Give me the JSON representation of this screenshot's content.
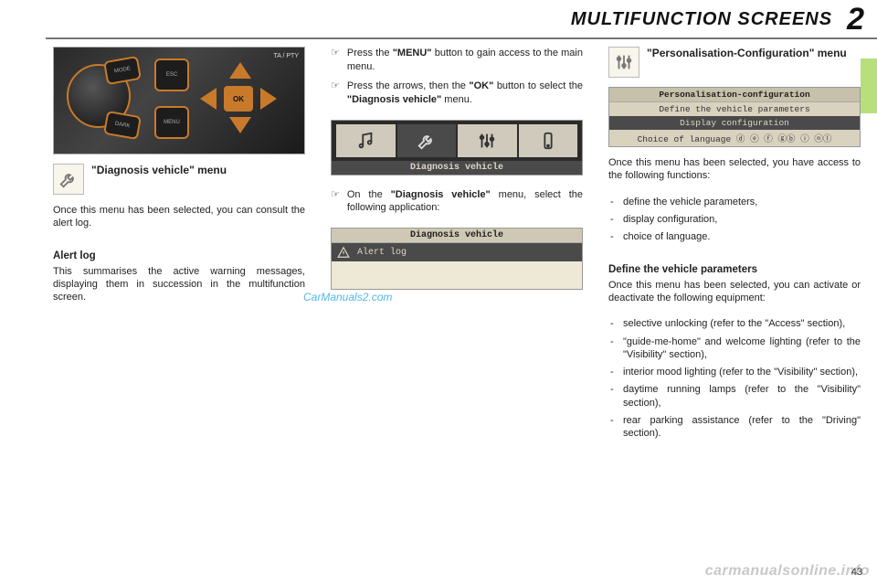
{
  "header": {
    "title": "MULTIFUNCTION SCREENS",
    "chapter": "2"
  },
  "col1": {
    "panel_labels": {
      "mode": "MODE",
      "dark": "DARK",
      "esc": "ESC",
      "menu": "MENU",
      "ok": "OK",
      "tapty": "TA / PTY"
    },
    "callout_title": "\"Diagnosis vehicle\" menu",
    "intro": "Once this menu has been selected, you can consult the alert log.",
    "alert_head": "Alert log",
    "alert_body": "This summarises the active warning messages, displaying them in succession in the multifunction screen."
  },
  "col2": {
    "steps": [
      {
        "pre": "Press the ",
        "bold": "\"MENU\"",
        "post": " button to gain access to the main menu."
      },
      {
        "pre": "Press the arrows, then the ",
        "bold": "\"OK\"",
        "post": " button to select the ",
        "bold2": "\"Diagnosis vehicle\"",
        "post2": " menu."
      }
    ],
    "lcd_label": "Diagnosis vehicle",
    "step3_pre": "On the ",
    "step3_bold": "\"Diagnosis vehicle\"",
    "step3_post": " menu, select the following application:",
    "lcd2_title": "Diagnosis vehicle",
    "lcd2_row": "Alert log"
  },
  "col3": {
    "callout_title": "\"Personalisation-Configuration\" menu",
    "lcd_title": "Personalisation-configuration",
    "lcd_rows": [
      "Define the vehicle parameters",
      "Display configuration",
      "Choice of language ⓓ ⓔ ⓕ ⓖⓑ ⓘ ⓝⓛ"
    ],
    "intro": "Once this menu has been selected, you have access to the following functions:",
    "funcs": [
      "define the vehicle parameters,",
      "display configuration,",
      "choice of language."
    ],
    "params_head": "Define the vehicle parameters",
    "params_intro": "Once this menu has been selected, you can activate or deactivate the following equipment:",
    "params": [
      "selective unlocking (refer to the \"Access\" section),",
      "\"guide-me-home\" and welcome lighting (refer to the \"Visibility\" section),",
      "interior mood lighting (refer to the \"Visibility\" section),",
      "daytime running lamps (refer to the \"Visibility\" section),",
      "rear parking assistance (refer to the \"Driving\" section)."
    ]
  },
  "footer": {
    "page": "43",
    "watermark": "carmanualsonline.info",
    "watermark2": "CarManuals2.com"
  }
}
